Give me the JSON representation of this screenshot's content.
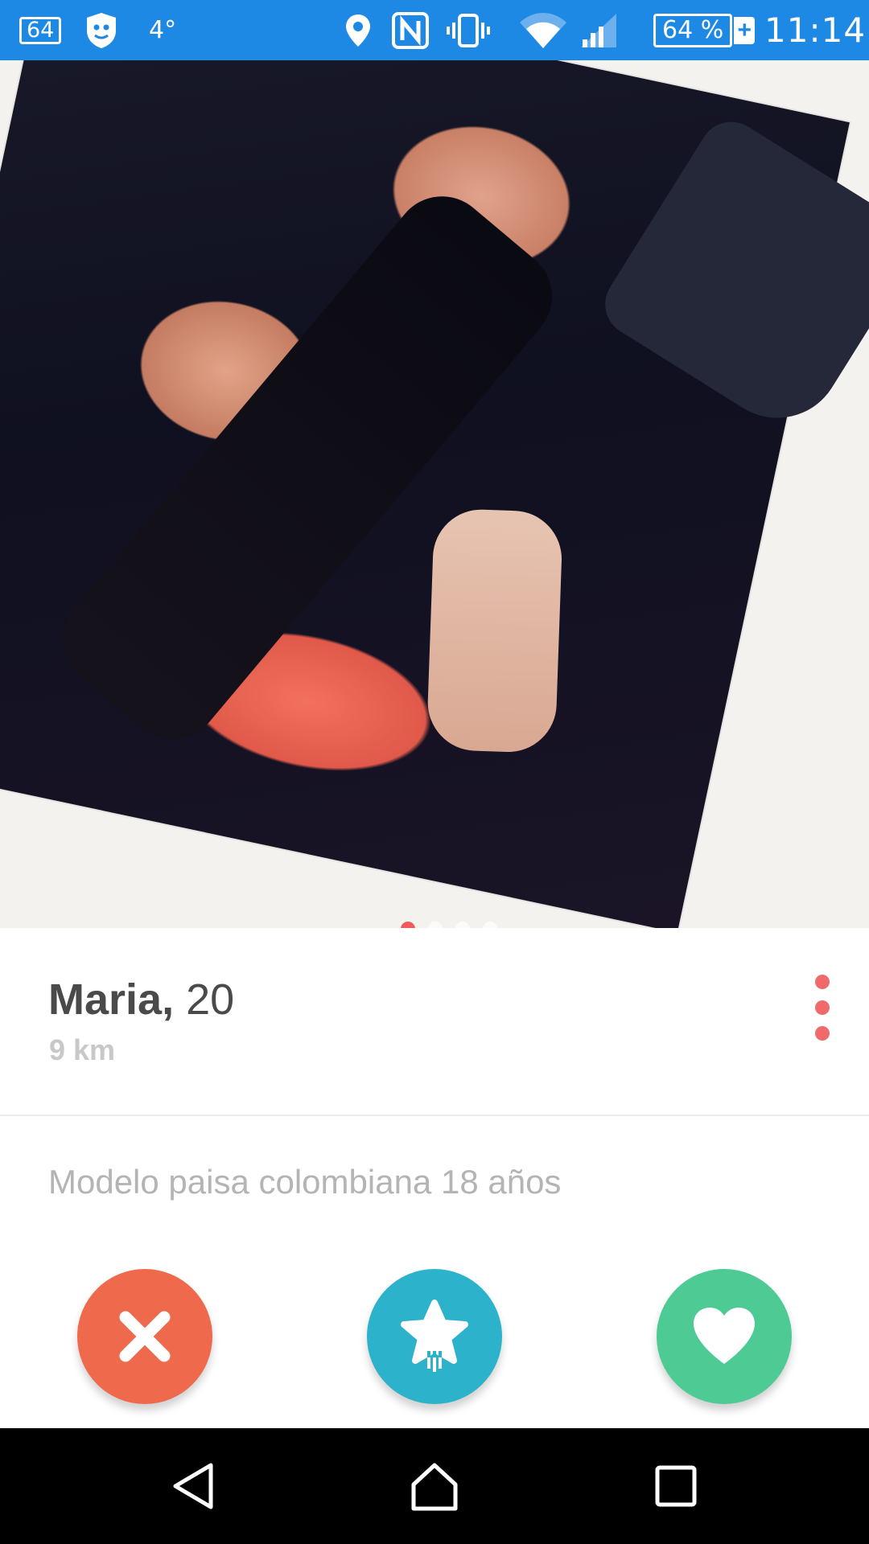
{
  "status_bar": {
    "badge": "64",
    "temperature": "4°",
    "battery": "64 %",
    "battery_plus": "+",
    "time": "11:14",
    "icons": [
      "badge-icon",
      "shield-icon",
      "location-icon",
      "nfc-icon",
      "vibrate-icon",
      "wifi-icon",
      "signal-icon",
      "battery-icon"
    ]
  },
  "photo": {
    "page_count": 4,
    "current_page": 1
  },
  "profile": {
    "name": "Maria,",
    "age": "20",
    "distance": "9 km",
    "bio": "Modelo paisa colombiana 18 años"
  },
  "actions": {
    "nope_icon": "close-icon",
    "superlike_icon": "star-icon",
    "like_icon": "heart-icon"
  },
  "colors": {
    "status_bar": "#1e88e5",
    "nope": "#ef6a4c",
    "superlike": "#2cb3cb",
    "like": "#4ecb94",
    "accent_dot": "#f05a5a"
  },
  "nav_bar": {
    "icons": [
      "back-icon",
      "home-icon",
      "recents-icon"
    ]
  }
}
